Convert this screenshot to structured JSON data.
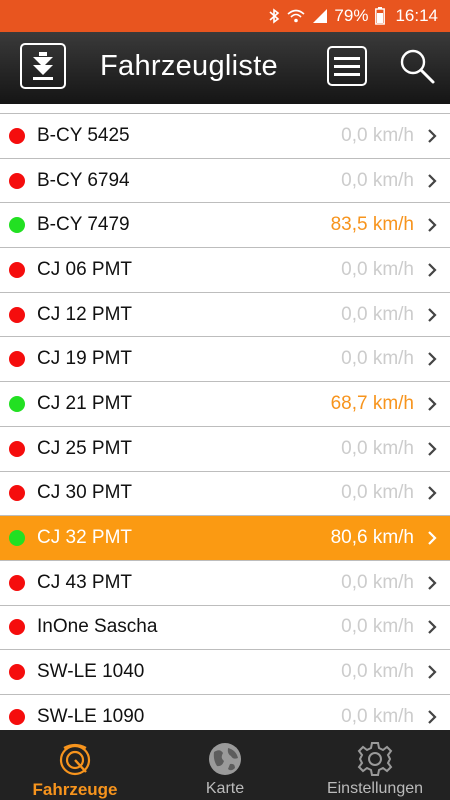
{
  "status_bar": {
    "battery_percent": "79%",
    "time": "16:14",
    "icons": [
      "bluetooth-icon",
      "wifi-icon",
      "signal-icon",
      "battery-icon"
    ]
  },
  "header": {
    "title": "Fahrzeugliste",
    "filter_icon": "filter-down-arrow-icon",
    "menu_icon": "hamburger-menu-icon",
    "search_icon": "search-icon"
  },
  "vehicles": [
    {
      "name": "B-CY 5425",
      "speed": "0,0 km/h",
      "status": "red",
      "selected": false
    },
    {
      "name": "B-CY 6794",
      "speed": "0,0 km/h",
      "status": "red",
      "selected": false
    },
    {
      "name": "B-CY 7479",
      "speed": "83,5 km/h",
      "status": "green",
      "selected": false
    },
    {
      "name": "CJ 06 PMT",
      "speed": "0,0 km/h",
      "status": "red",
      "selected": false
    },
    {
      "name": "CJ 12 PMT",
      "speed": "0,0 km/h",
      "status": "red",
      "selected": false
    },
    {
      "name": "CJ 19 PMT",
      "speed": "0,0 km/h",
      "status": "red",
      "selected": false
    },
    {
      "name": "CJ 21 PMT",
      "speed": "68,7 km/h",
      "status": "green",
      "selected": false
    },
    {
      "name": "CJ 25 PMT",
      "speed": "0,0 km/h",
      "status": "red",
      "selected": false
    },
    {
      "name": "CJ 30 PMT",
      "speed": "0,0 km/h",
      "status": "red",
      "selected": false
    },
    {
      "name": "CJ 32 PMT",
      "speed": "80,6 km/h",
      "status": "green",
      "selected": true
    },
    {
      "name": "CJ 43 PMT",
      "speed": "0,0 km/h",
      "status": "red",
      "selected": false
    },
    {
      "name": "InOne Sascha",
      "speed": "0,0 km/h",
      "status": "red",
      "selected": false
    },
    {
      "name": "SW-LE 1040",
      "speed": "0,0 km/h",
      "status": "red",
      "selected": false
    },
    {
      "name": "SW-LE 1090",
      "speed": "0,0 km/h",
      "status": "red",
      "selected": false
    }
  ],
  "bottom_nav": [
    {
      "label": "Fahrzeuge",
      "icon": "vehicles-radar-icon",
      "active": true
    },
    {
      "label": "Karte",
      "icon": "globe-icon",
      "active": false
    },
    {
      "label": "Einstellungen",
      "icon": "gear-icon",
      "active": false
    }
  ],
  "colors": {
    "status_bar": "#e8551f",
    "accent_orange": "#f7941d",
    "selected_row": "#fb9a12",
    "status_red": "#f50d0d",
    "status_green": "#22e022",
    "idle_speed": "#cccccc"
  }
}
